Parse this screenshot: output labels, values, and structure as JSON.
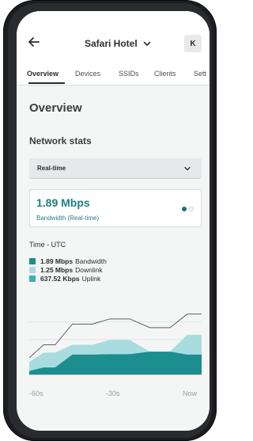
{
  "header": {
    "title": "Safari Hotel",
    "avatar": "K"
  },
  "tabs": [
    {
      "label": "Overview",
      "active": true
    },
    {
      "label": "Devices",
      "active": false
    },
    {
      "label": "SSIDs",
      "active": false
    },
    {
      "label": "Clients",
      "active": false
    },
    {
      "label": "Sett",
      "active": false
    }
  ],
  "page_title": "Overview",
  "section_title": "Network stats",
  "range_select": {
    "value": "Real-time"
  },
  "stat_card": {
    "value": "1.89 Mbps",
    "label": "Bandwidth (Real-time)"
  },
  "time_label": "Time - UTC",
  "legend": [
    {
      "value": "1.89 Mbps",
      "label": "Bandwidth"
    },
    {
      "value": "1.25 Mbps",
      "label": "Downlink"
    },
    {
      "value": "637.52 Kbps",
      "label": "Uplink"
    }
  ],
  "x_axis": [
    "-60s",
    "-30s",
    "Now"
  ],
  "colors": {
    "accent": "#1f7f7f",
    "bandwidth": "#1c8e8f",
    "downlink": "#a9dcdf",
    "uplink": "#3cb0b3",
    "bandwidth_line": "#5c5f62"
  },
  "icons": {
    "back": "arrow-left-icon",
    "title_menu": "chevron-down-icon",
    "select": "chevron-down-icon"
  },
  "chart_data": {
    "type": "area",
    "title": "",
    "x": [
      -60,
      -55,
      -51,
      -45,
      -38,
      -32,
      -25,
      -18,
      -11,
      -5,
      0
    ],
    "x_tick_labels": [
      "-60s",
      "-30s",
      "Now"
    ],
    "series": [
      {
        "name": "Bandwidth",
        "values": [
          0.54,
          0.94,
          0.94,
          1.58,
          1.58,
          1.74,
          1.74,
          1.47,
          1.47,
          1.89,
          1.89
        ]
      },
      {
        "name": "Downlink",
        "values": [
          0.41,
          0.7,
          0.7,
          0.94,
          0.94,
          1.09,
          1.09,
          0.73,
          0.73,
          1.25,
          1.25
        ]
      },
      {
        "name": "Uplink",
        "values": [
          0.13,
          0.24,
          0.24,
          0.64,
          0.64,
          0.65,
          0.65,
          0.73,
          0.73,
          0.64,
          0.64
        ]
      }
    ],
    "ylim": [
      0,
      2.2
    ],
    "grid": true,
    "legend": "top-left"
  }
}
